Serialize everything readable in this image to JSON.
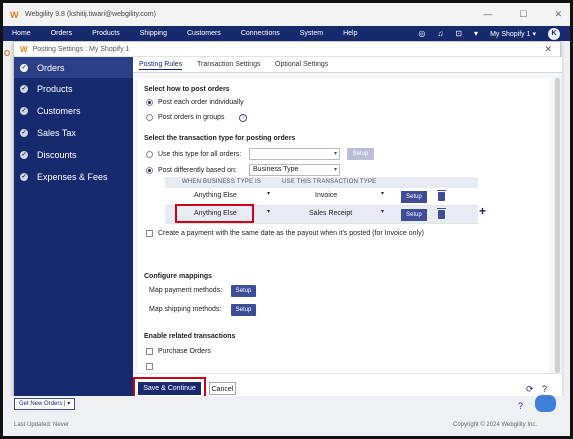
{
  "window": {
    "title": "Webgility 9.8 (kshitij.tiwari@webgility.com)",
    "controls": [
      "—",
      "☐",
      "✕"
    ]
  },
  "menubar": {
    "items": [
      "Home",
      "Orders",
      "Products",
      "Shipping",
      "Customers",
      "Connections",
      "System",
      "Help"
    ],
    "store": "My Shopify 1",
    "avatar": "K"
  },
  "dialog": {
    "title": "Posting Settings : My Shopify 1",
    "close": "✕"
  },
  "sidebar": {
    "items": [
      {
        "label": "Orders",
        "active": true
      },
      {
        "label": "Products"
      },
      {
        "label": "Customers"
      },
      {
        "label": "Sales Tax"
      },
      {
        "label": "Discounts"
      },
      {
        "label": "Expenses & Fees"
      }
    ]
  },
  "tabs": [
    "Posting Rules",
    "Transaction Settings",
    "Optional Settings"
  ],
  "how": {
    "heading": "Select how to post orders",
    "opt1": "Post each order individually",
    "opt2": "Post orders in groups",
    "info": "i"
  },
  "type": {
    "heading": "Select the transaction type for posting orders",
    "opt1": "Use this type for all orders:",
    "setup_disabled": "Setup",
    "opt2": "Post differently based on:",
    "based_on": "Business Type"
  },
  "mapping_table": {
    "col1": "WHEN BUSINESS TYPE IS",
    "col2": "USE THIS TRANSACTION TYPE",
    "rows": [
      {
        "when": "Anything Else",
        "use": "Invoice",
        "setup": "Setup"
      },
      {
        "when": "Anything Else",
        "use": "Sales Receipt",
        "setup": "Setup"
      }
    ]
  },
  "payment_option": "Create a payment with the same date as the payout when it's posted (for Invoice only)",
  "configure": {
    "heading": "Configure mappings",
    "payment_label": "Map payment methods:",
    "shipping_label": "Map shipping methods:",
    "setup": "Setup"
  },
  "related": {
    "heading": "Enable related transactions",
    "item1": "Purchase Orders"
  },
  "footer": {
    "save": "Save & Continue",
    "cancel": "Cancel"
  },
  "bottom": {
    "get_new": "Get New Orders",
    "last_updated": "Last Updated: Never",
    "copyright": "Copyright © 2024 Webgility Inc."
  },
  "colors": {
    "navy": "#172a6e",
    "highlight": "#d0021b",
    "brand_orange": "#e67e22"
  }
}
